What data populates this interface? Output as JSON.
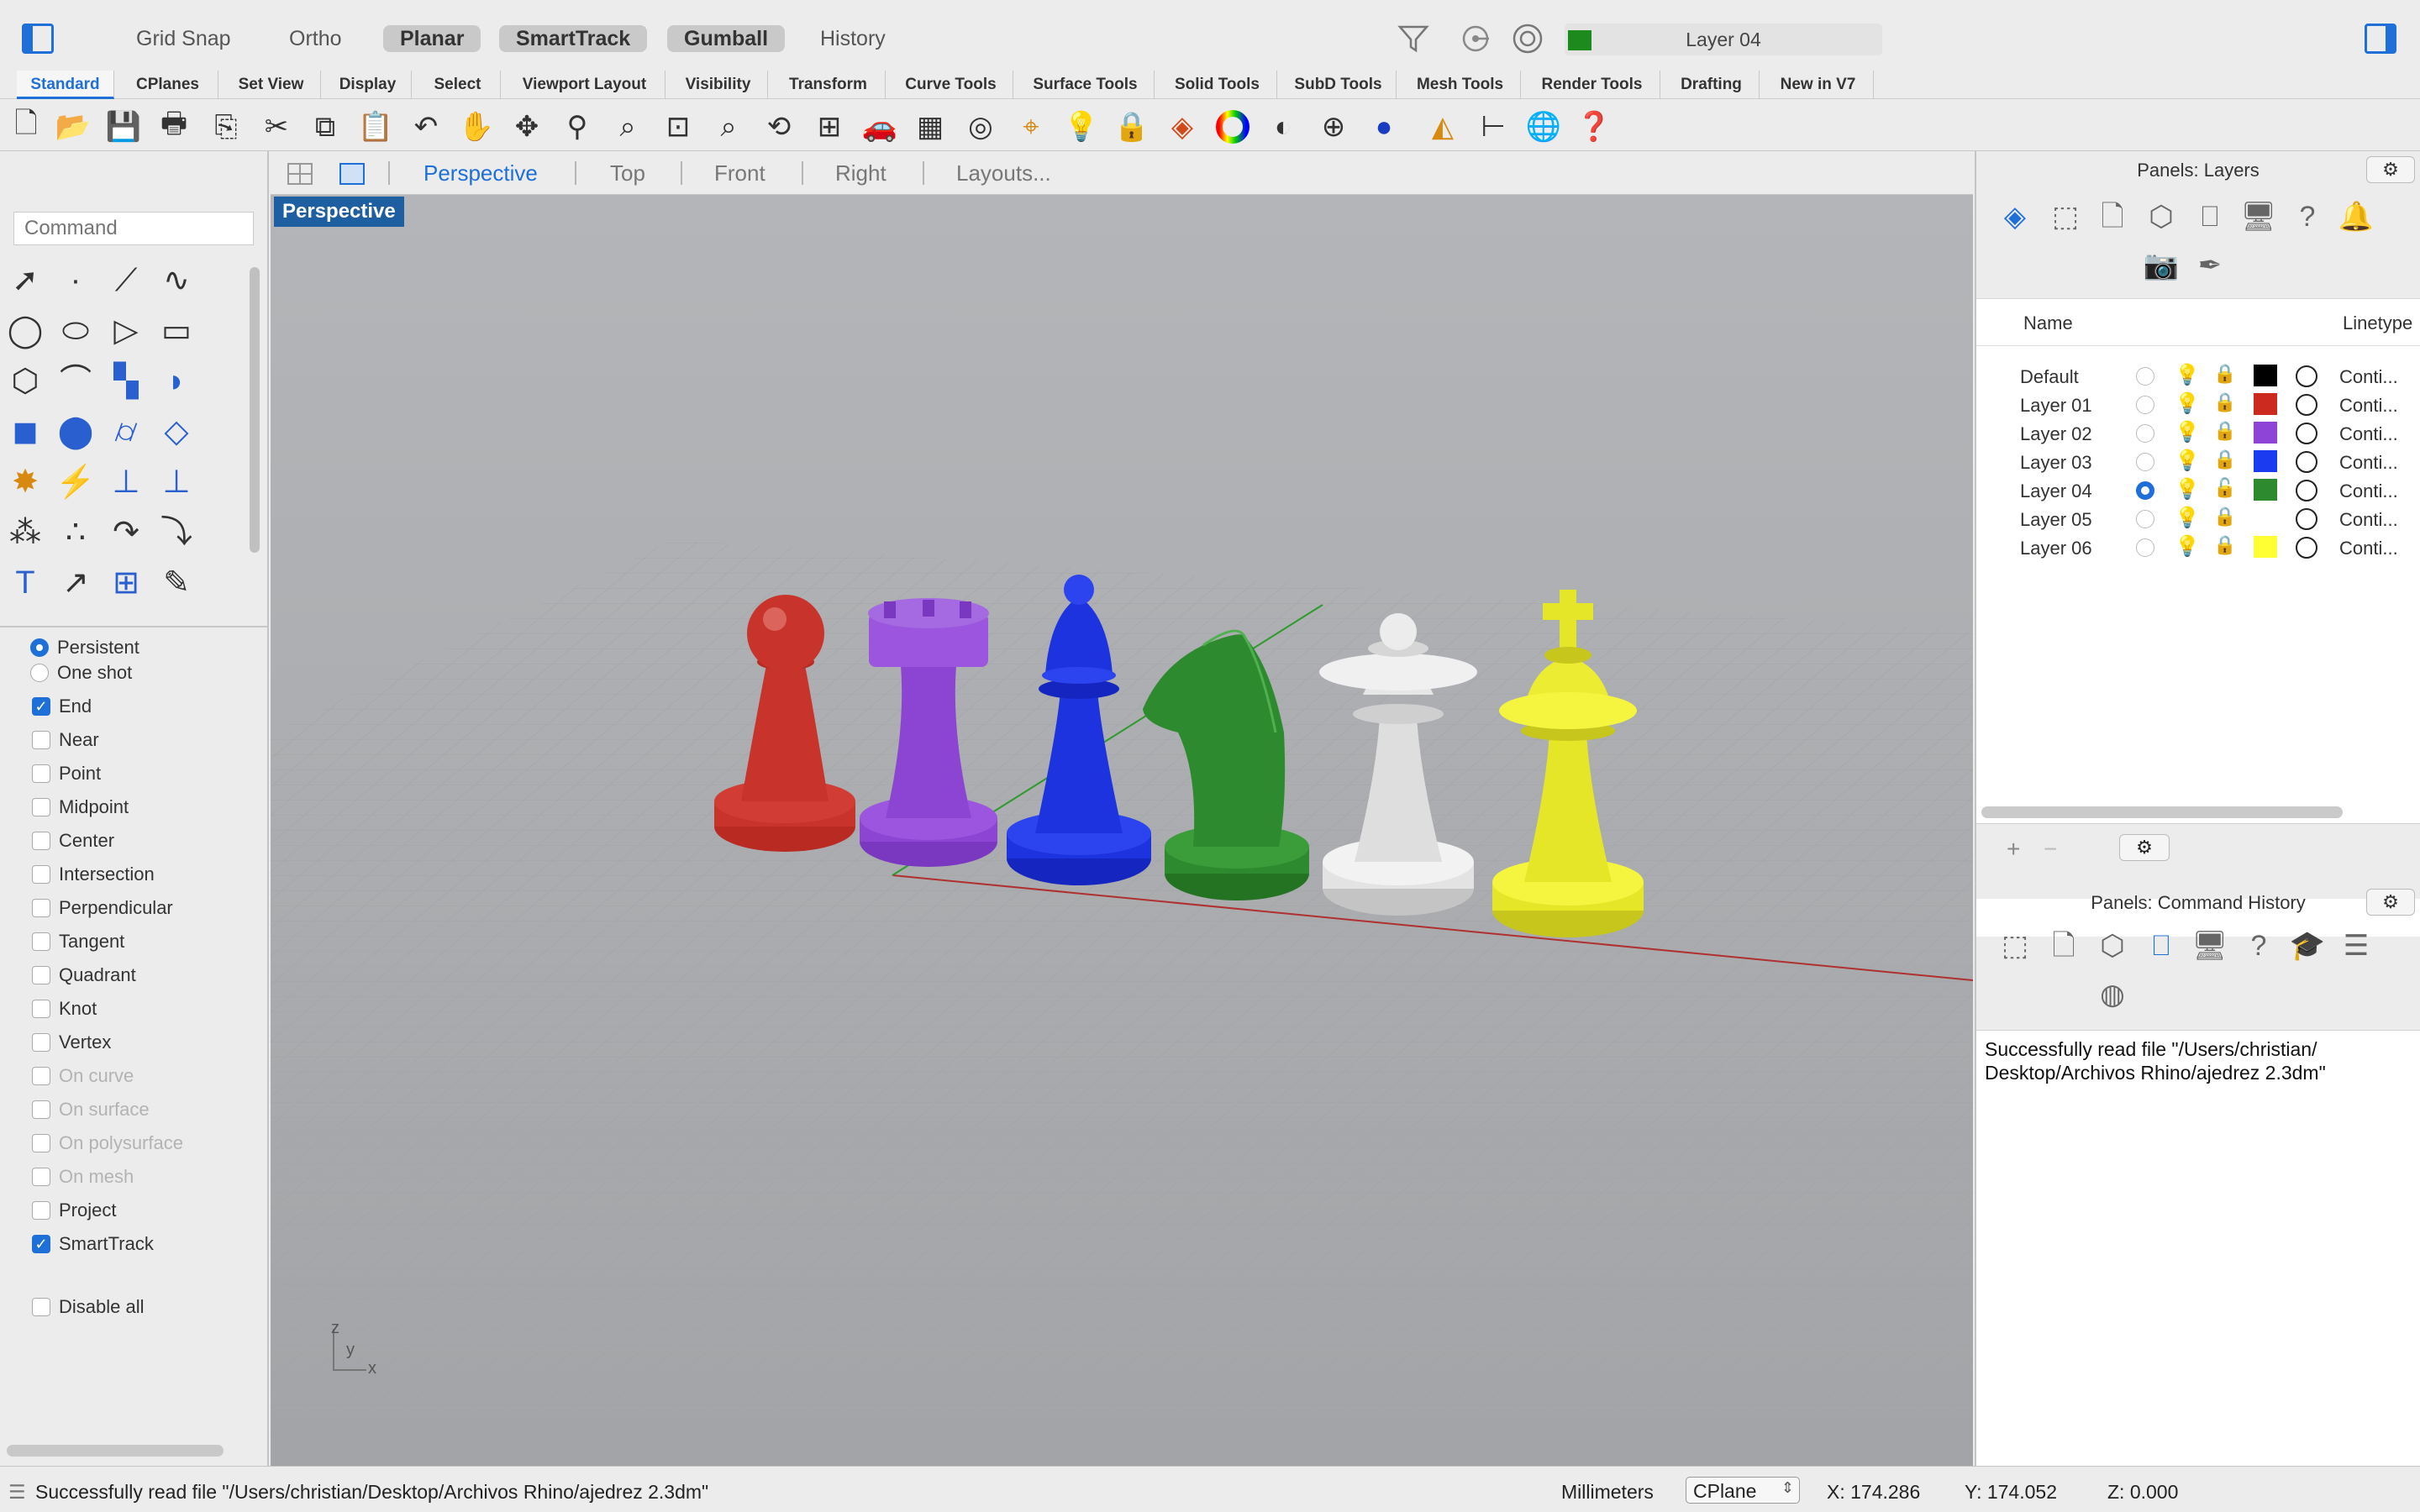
{
  "topbar": {
    "modes": [
      {
        "label": "Grid Snap",
        "active": false
      },
      {
        "label": "Ortho",
        "active": false
      },
      {
        "label": "Planar",
        "active": true
      },
      {
        "label": "SmartTrack",
        "active": true
      },
      {
        "label": "Gumball",
        "active": true
      },
      {
        "label": "History",
        "active": false
      }
    ],
    "current_layer": "Layer 04",
    "current_layer_color": "#1d8a1d"
  },
  "tabs": [
    "Standard",
    "CPlanes",
    "Set View",
    "Display",
    "Select",
    "Viewport Layout",
    "Visibility",
    "Transform",
    "Curve Tools",
    "Surface Tools",
    "Solid Tools",
    "SubD Tools",
    "Mesh Tools",
    "Render Tools",
    "Drafting",
    "New in V7"
  ],
  "active_tab": "Standard",
  "toolbar_icons": [
    "new-file-icon",
    "open-folder-icon",
    "save-icon",
    "print-icon",
    "import-icon",
    "cut-icon",
    "copy-icon",
    "paste-icon",
    "undo-icon",
    "pan-hand-icon",
    "rotate-view-icon",
    "zoom-icon",
    "zoom-window-icon",
    "zoom-extents-icon",
    "zoom-selected-icon",
    "undo-view-icon",
    "viewport-layout-icon",
    "car-icon",
    "grid-icon",
    "snapshot-icon",
    "osnap-icon",
    "light-bulb-icon",
    "lock-icon",
    "layer-color-icon",
    "color-wheel-icon",
    "shaded-sphere-icon",
    "wireframe-sphere-icon",
    "rendered-sphere-icon",
    "analyze-icon",
    "dimension-icon",
    "web-globe-icon",
    "help-icon"
  ],
  "command": {
    "placeholder": "Command"
  },
  "osnap": {
    "mode_options": [
      {
        "label": "Persistent",
        "selected": true
      },
      {
        "label": "One shot",
        "selected": false
      }
    ],
    "items": [
      {
        "label": "End",
        "checked": true,
        "enabled": true
      },
      {
        "label": "Near",
        "checked": false,
        "enabled": true
      },
      {
        "label": "Point",
        "checked": false,
        "enabled": true
      },
      {
        "label": "Midpoint",
        "checked": false,
        "enabled": true
      },
      {
        "label": "Center",
        "checked": false,
        "enabled": true
      },
      {
        "label": "Intersection",
        "checked": false,
        "enabled": true
      },
      {
        "label": "Perpendicular",
        "checked": false,
        "enabled": true
      },
      {
        "label": "Tangent",
        "checked": false,
        "enabled": true
      },
      {
        "label": "Quadrant",
        "checked": false,
        "enabled": true
      },
      {
        "label": "Knot",
        "checked": false,
        "enabled": true
      },
      {
        "label": "Vertex",
        "checked": false,
        "enabled": true
      },
      {
        "label": "On curve",
        "checked": false,
        "enabled": false
      },
      {
        "label": "On surface",
        "checked": false,
        "enabled": false
      },
      {
        "label": "On polysurface",
        "checked": false,
        "enabled": false
      },
      {
        "label": "On mesh",
        "checked": false,
        "enabled": false
      },
      {
        "label": "Project",
        "checked": false,
        "enabled": true
      },
      {
        "label": "SmartTrack",
        "checked": true,
        "enabled": true
      }
    ],
    "disable_all": {
      "label": "Disable all",
      "checked": false
    }
  },
  "viewport_tabs": [
    {
      "label": "Perspective",
      "active": true
    },
    {
      "label": "Top",
      "active": false
    },
    {
      "label": "Front",
      "active": false
    },
    {
      "label": "Right",
      "active": false
    },
    {
      "label": "Layouts...",
      "active": false
    }
  ],
  "viewport": {
    "label": "Perspective",
    "axis_labels": {
      "z": "z",
      "y": "y",
      "x": "x"
    }
  },
  "layers_panel": {
    "title": "Panels: Layers",
    "gear": "⚙︎",
    "columns": {
      "name": "Name",
      "linetype": "Linetype"
    },
    "layers": [
      {
        "name": "Default",
        "current": false,
        "visible": false,
        "locked": true,
        "color": "#000000",
        "linetype": "Conti..."
      },
      {
        "name": "Layer 01",
        "current": false,
        "visible": true,
        "locked": true,
        "color": "#cc2a1e",
        "linetype": "Conti..."
      },
      {
        "name": "Layer 02",
        "current": false,
        "visible": true,
        "locked": true,
        "color": "#8e44d6",
        "linetype": "Conti..."
      },
      {
        "name": "Layer 03",
        "current": false,
        "visible": true,
        "locked": true,
        "color": "#1a3cf0",
        "linetype": "Conti..."
      },
      {
        "name": "Layer 04",
        "current": true,
        "visible": false,
        "locked": false,
        "color": "#2e8a2e",
        "linetype": "Conti..."
      },
      {
        "name": "Layer 05",
        "current": false,
        "visible": true,
        "locked": true,
        "color": "#ffffff",
        "linetype": "Conti..."
      },
      {
        "name": "Layer 06",
        "current": false,
        "visible": true,
        "locked": true,
        "color": "#ffff33",
        "linetype": "Conti..."
      }
    ],
    "add_label": "+",
    "remove_label": "−"
  },
  "history_panel": {
    "title": "Panels: Command History",
    "text": "Successfully read file \"/Users/christian/\nDesktop/Archivos Rhino/ajedrez 2.3dm\""
  },
  "status": {
    "message": "Successfully read file \"/Users/christian/Desktop/Archivos Rhino/ajedrez 2.3dm\"",
    "units": "Millimeters",
    "cplane": "CPlane",
    "x": "X: 174.286",
    "y": "Y: 174.052",
    "z": "Z: 0.000"
  },
  "colors": {
    "accent": "#1f6fd8",
    "viewport_bg": "#a9abae",
    "label_bg": "#1d5fa0"
  }
}
